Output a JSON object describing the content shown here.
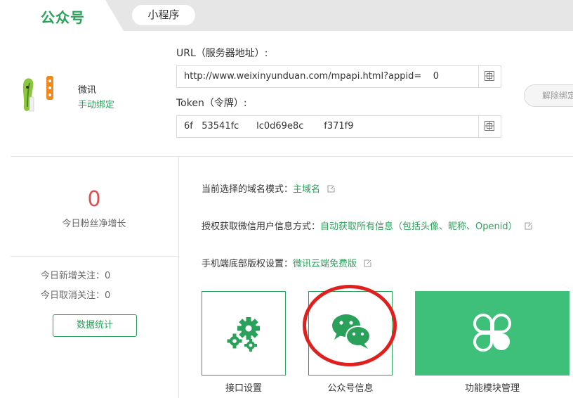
{
  "tabs": {
    "official": "公众号",
    "mini": "小程序"
  },
  "account": {
    "name": "微讯",
    "bind_link": "手动绑定",
    "unbind_button": "解除绑定"
  },
  "url": {
    "label": "URL（服务器地址）:",
    "value": "http://www.weixinyunduan.com/mpapi.html?appid=    0"
  },
  "token": {
    "label": "Token（令牌）:",
    "value": "6f   53541fc      lc0d69e8c       f371f9"
  },
  "stats": {
    "fans_today": "0",
    "fans_label": "今日粉丝净增长",
    "new_label": "今日新增关注：",
    "new_value": "0",
    "cancel_label": "今日取消关注：",
    "cancel_value": "0",
    "button": "数据统计"
  },
  "settings": [
    {
      "label": "当前选择的域名模式：",
      "value": "主域名"
    },
    {
      "label": "授权获取微信用户信息方式：",
      "value": "自动获取所有信息（包括头像、昵称、Openid）"
    },
    {
      "label": "手机端底部版权设置：",
      "value": "微讯云端免费版"
    }
  ],
  "cards": {
    "interface": "接口设置",
    "account_info": "公众号信息",
    "modules": "功能模块管理"
  },
  "colors": {
    "accent": "#2aa15a",
    "card_green": "#3ec07a",
    "highlight_circle": "#e01f1f",
    "fans_number": "#e05050"
  }
}
